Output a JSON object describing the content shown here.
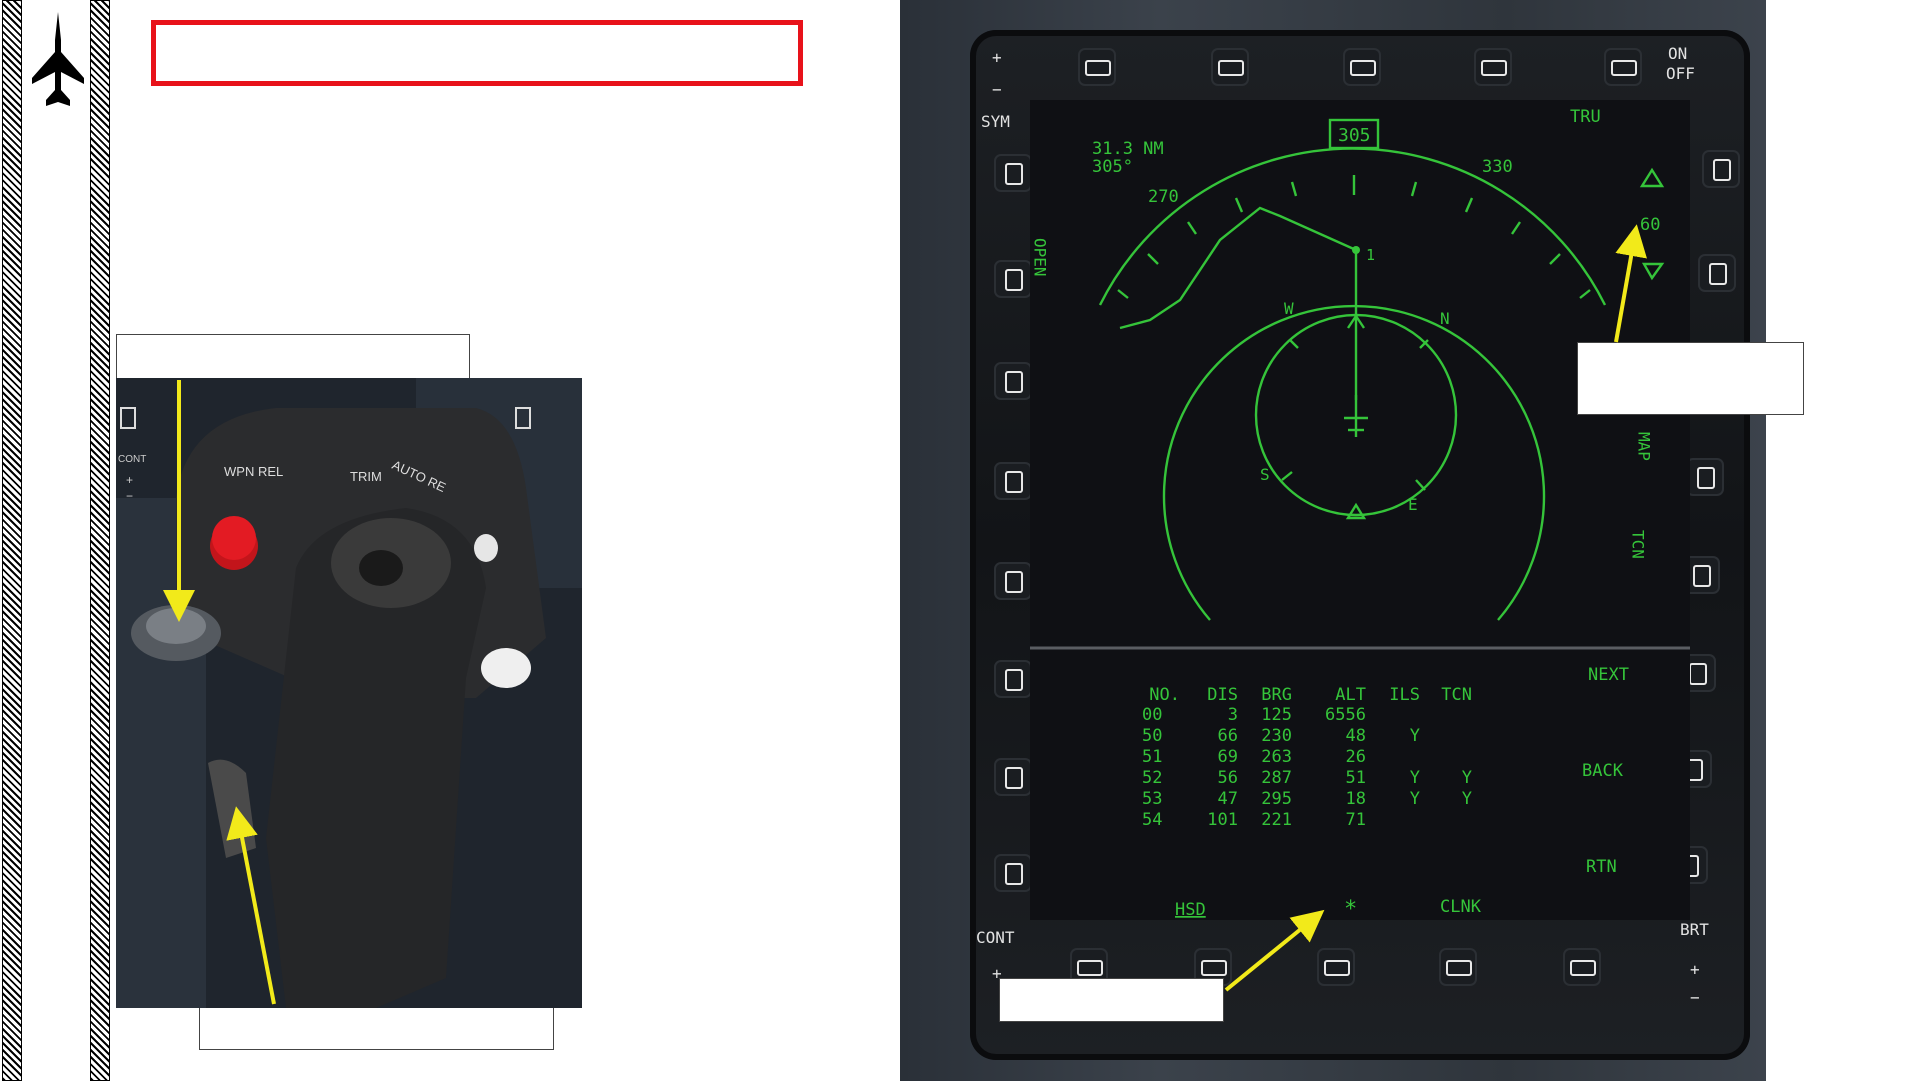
{
  "colors": {
    "title_border": "#e8121a",
    "arrow": "#f2ea1a",
    "mfd_green": "#35c43a"
  },
  "sidebar": {
    "icon": "jet-silhouette-icon"
  },
  "stick_photo": {
    "panel_labels": [
      "WPN REL",
      "TRIM",
      "AUTO RE"
    ],
    "side_left": {
      "top": "CONT",
      "plus": "+",
      "minus": "−"
    }
  },
  "mfd": {
    "bezel": {
      "sym": "SYM",
      "on": "ON",
      "off": "OFF",
      "cont": "CONT",
      "brt": "BRT",
      "plus": "+",
      "minus": "−"
    },
    "hsd": {
      "heading_box": "305",
      "range_nm": "31.3 NM",
      "bearing": "305°",
      "tick_270": "270",
      "tick_330": "330",
      "tru": "TRU",
      "range_scale": "60",
      "open": "OPEN",
      "compass": {
        "w": "W",
        "n": "N",
        "s": "S",
        "e": "E"
      },
      "waypoint": "1",
      "right_labels": {
        "map": "MAP",
        "tcn": "TCN",
        "next": "NEXT",
        "back": "BACK",
        "rtn": "RTN"
      },
      "bottom_labels": {
        "hsd": "HSD",
        "star": "*",
        "clnk": "CLNK"
      }
    },
    "table": {
      "headers": [
        "NO.",
        "DIS",
        "BRG",
        "ALT",
        "ILS",
        "TCN"
      ],
      "rows": [
        [
          "00",
          "3",
          "125",
          "6556",
          "",
          ""
        ],
        [
          "50",
          "66",
          "230",
          "48",
          "Y",
          ""
        ],
        [
          "51",
          "69",
          "263",
          "26",
          "",
          ""
        ],
        [
          "52",
          "56",
          "287",
          "51",
          "Y",
          "Y"
        ],
        [
          "53",
          "47",
          "295",
          "18",
          "Y",
          "Y"
        ],
        [
          "54",
          "101",
          "221",
          "71",
          "",
          ""
        ]
      ]
    }
  }
}
